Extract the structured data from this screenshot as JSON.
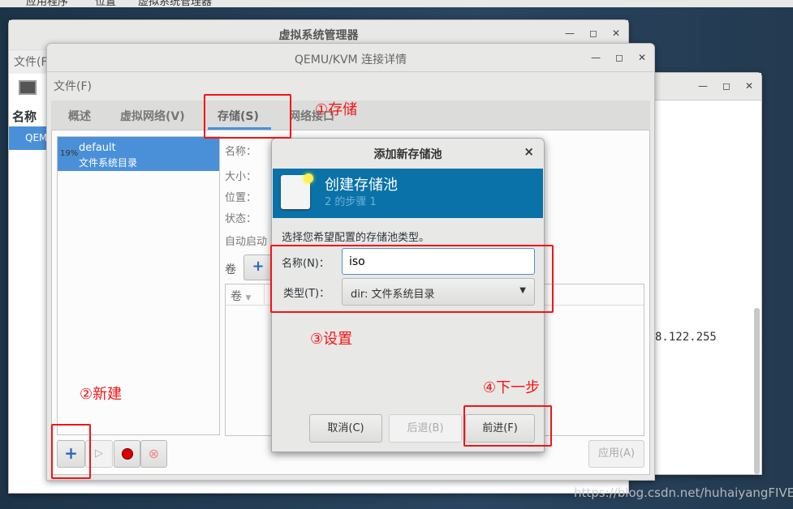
{
  "topbar": {
    "items": [
      "应用程序",
      "位置",
      "虚拟系统管理器"
    ]
  },
  "manager": {
    "title": "虚拟系统管理器",
    "menu": "文件(F",
    "list_header": "名称",
    "list_item": "QEM"
  },
  "details": {
    "title": "QEMU/KVM 连接详情",
    "menu": "文件(F)",
    "tabs": [
      "概述",
      "虚拟网络(V)",
      "存储(S)",
      "网络接口"
    ],
    "pool": {
      "usage": "19%",
      "name": "default",
      "type": "文件系统目录"
    },
    "fields": [
      "名称：",
      "大小：",
      "位置：",
      "状态：",
      "自动启动"
    ],
    "volumes_label": "卷",
    "volume_column": "卷",
    "apply": "应用(A)"
  },
  "right_window": {
    "text": "8.122.255"
  },
  "dialog": {
    "title": "添加新存储池",
    "banner_title": "创建存储池",
    "banner_step": "2 的步骤 1",
    "prompt": "选择您希望配置的存储池类型。",
    "name_label": "名称(N)：",
    "name_value": "iso",
    "type_label": "类型(T)：",
    "type_value": "dir: 文件系统目录",
    "cancel": "取消(C)",
    "back": "后退(B)",
    "forward": "前进(F)"
  },
  "annotations": {
    "a1": "①存储",
    "a2": "②新建",
    "a3": "③设置",
    "a4": "④下一步"
  },
  "watermark": "https://blog.csdn.net/huhaiyangFIVE",
  "colors": {
    "accent": "#4a90d9",
    "banner": "#0a72a8",
    "annotation": "#f51414"
  }
}
